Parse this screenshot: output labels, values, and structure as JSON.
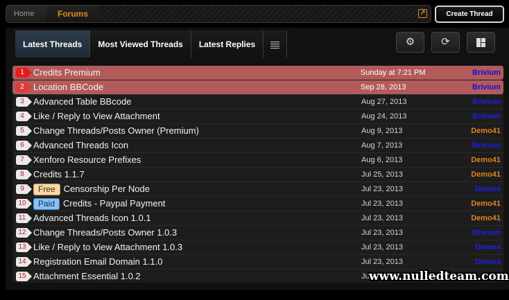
{
  "breadcrumb": {
    "home": "Home",
    "current": "Forums"
  },
  "header": {
    "create_label": "Create Thread"
  },
  "tabs": [
    {
      "label": "Latest Threads",
      "active": true
    },
    {
      "label": "Most Viewed Threads",
      "active": false
    },
    {
      "label": "Latest Replies",
      "active": false
    }
  ],
  "icons": {
    "menu": "hamburger-icon",
    "settings": "gear-icon",
    "refresh": "refresh-icon",
    "layout": "layout-icon",
    "jump": "external-link-icon"
  },
  "colors": {
    "accent": "#e08a1e",
    "highlight_row": "#b35a5a",
    "user_blue": "#2222ee",
    "user_orange": "#e0821e"
  },
  "threads": [
    {
      "num": "1",
      "prefix": "",
      "title": "Credits Premium",
      "date": "Sunday at 7:21 PM",
      "user": "Brivium",
      "user_color": "#1010dd",
      "highlight": true
    },
    {
      "num": "2",
      "prefix": "",
      "title": "Location BBCode",
      "date": "Sep 28, 2013",
      "user": "Brivium",
      "user_color": "#1010dd",
      "highlight": true
    },
    {
      "num": "3",
      "prefix": "",
      "title": "Advanced Table BBcode",
      "date": "Aug 27, 2013",
      "user": "Brivium",
      "user_color": "#1f1fe8",
      "highlight": false
    },
    {
      "num": "4",
      "prefix": "",
      "title": "Like / Reply to View Attachment",
      "date": "Aug 24, 2013",
      "user": "Brivium",
      "user_color": "#1f1fe8",
      "highlight": false
    },
    {
      "num": "5",
      "prefix": "",
      "title": "Change Threads/Posts Owner (Premium)",
      "date": "Aug 9, 2013",
      "user": "Demo41",
      "user_color": "#e0821e",
      "highlight": false
    },
    {
      "num": "6",
      "prefix": "",
      "title": "Advanced Threads Icon",
      "date": "Aug 7, 2013",
      "user": "Brivium",
      "user_color": "#1f1fe8",
      "highlight": false
    },
    {
      "num": "7",
      "prefix": "",
      "title": "Xenforo Resource Prefixes",
      "date": "Aug 6, 2013",
      "user": "Demo41",
      "user_color": "#e0821e",
      "highlight": false
    },
    {
      "num": "8",
      "prefix": "",
      "title": "Credits 1.1.7",
      "date": "Jul 25, 2013",
      "user": "Demo41",
      "user_color": "#e0821e",
      "highlight": false
    },
    {
      "num": "9",
      "prefix": "Free",
      "title": "Censorship Per Node",
      "date": "Jul 23, 2013",
      "user": "Demo4",
      "user_color": "#1f1fe8",
      "highlight": false
    },
    {
      "num": "10",
      "prefix": "Paid",
      "title": "Credits - Paypal Payment",
      "date": "Jul 23, 2013",
      "user": "Demo41",
      "user_color": "#e0821e",
      "highlight": false
    },
    {
      "num": "11",
      "prefix": "",
      "title": "Advanced Threads Icon 1.0.1",
      "date": "Jul 23, 2013",
      "user": "Demo41",
      "user_color": "#e0821e",
      "highlight": false
    },
    {
      "num": "12",
      "prefix": "",
      "title": "Change Threads/Posts Owner 1.0.3",
      "date": "Jul 23, 2013",
      "user": "Brivium",
      "user_color": "#1f1fe8",
      "highlight": false
    },
    {
      "num": "13",
      "prefix": "",
      "title": "Like / Reply to View Attachment 1.0.3",
      "date": "Jul 23, 2013",
      "user": "Demo4",
      "user_color": "#1f1fe8",
      "highlight": false
    },
    {
      "num": "14",
      "prefix": "",
      "title": "Registration Email Domain 1.1.0",
      "date": "Jul 23, 2013",
      "user": "Demo4",
      "user_color": "#1f1fe8",
      "highlight": false
    },
    {
      "num": "15",
      "prefix": "",
      "title": "Attachment Essential 1.0.2",
      "date": "Ju",
      "user": "",
      "user_color": "#1f1fe8",
      "highlight": false
    }
  ],
  "watermark": "www.nulledteam.com"
}
